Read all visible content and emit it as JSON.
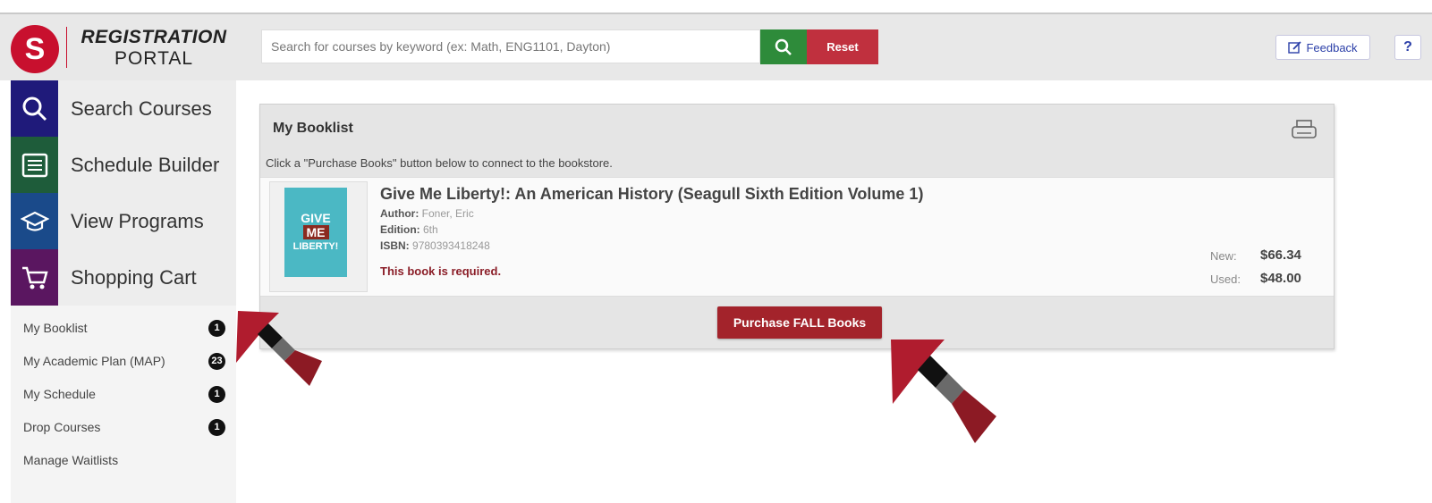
{
  "header": {
    "logo_letter": "S",
    "brand_line1": "REGISTRATION",
    "brand_line2": "PORTAL",
    "search_placeholder": "Search for courses by keyword (ex: Math, ENG1101, Dayton)",
    "reset_label": "Reset",
    "feedback_label": "Feedback",
    "help_label": "?"
  },
  "sidebar": {
    "nav": [
      {
        "label": "Search Courses",
        "color": "#1f1a7a",
        "icon": "search-icon"
      },
      {
        "label": "Schedule Builder",
        "color": "#1e5c3a",
        "icon": "list-icon"
      },
      {
        "label": "View Programs",
        "color": "#1a4a8a",
        "icon": "graduation-cap-icon"
      },
      {
        "label": "Shopping Cart",
        "color": "#5a1660",
        "icon": "cart-icon"
      }
    ],
    "sub_items": [
      {
        "label": "My Booklist",
        "badge": "1"
      },
      {
        "label": "My Academic Plan (MAP)",
        "badge": "23"
      },
      {
        "label": "My Schedule",
        "badge": "1"
      },
      {
        "label": "Drop Courses",
        "badge": "1"
      },
      {
        "label": "Manage Waitlists",
        "badge": ""
      }
    ]
  },
  "booklist": {
    "title": "My Booklist",
    "note": "Click a \"Purchase Books\" button below to connect to the bookstore.",
    "book": {
      "cover_line1": "GIVE",
      "cover_line2": "ME",
      "cover_line3": "LIBERTY!",
      "title": "Give Me Liberty!: An American History (Seagull Sixth Edition Volume 1)",
      "author_label": "Author:",
      "author": "Foner, Eric",
      "edition_label": "Edition:",
      "edition": "6th",
      "isbn_label": "ISBN:",
      "isbn": "9780393418248",
      "required_text": "This book is required.",
      "new_label": "New:",
      "new_price": "$66.34",
      "used_label": "Used:",
      "used_price": "$48.00"
    },
    "purchase_label": "Purchase FALL Books"
  },
  "colors": {
    "accent_red": "#a3232b",
    "search_green": "#2e8b3a"
  }
}
